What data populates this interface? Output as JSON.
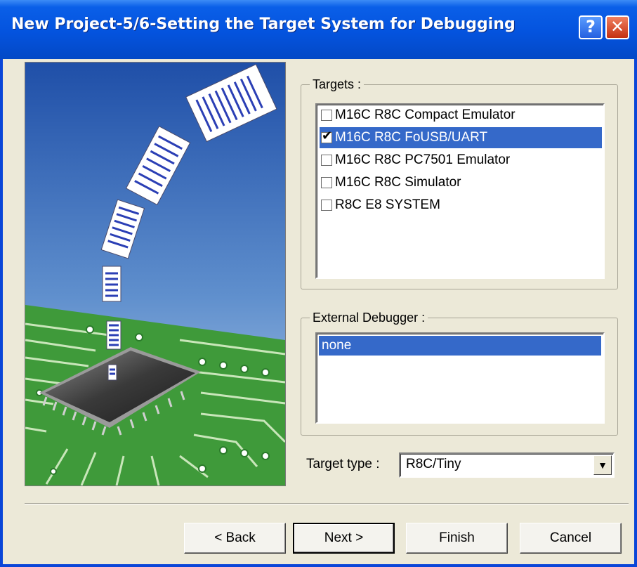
{
  "window": {
    "title": "New Project-5/6-Setting the Target System for Debugging"
  },
  "titlebar_buttons": {
    "help": "?",
    "close": "✕"
  },
  "targets": {
    "label": "Targets :",
    "items": [
      {
        "label": "M16C R8C Compact Emulator",
        "checked": false,
        "selected": false
      },
      {
        "label": "M16C R8C FoUSB/UART",
        "checked": true,
        "selected": true
      },
      {
        "label": "M16C R8C PC7501 Emulator",
        "checked": false,
        "selected": false
      },
      {
        "label": "M16C R8C Simulator",
        "checked": false,
        "selected": false
      },
      {
        "label": "R8C E8 SYSTEM",
        "checked": false,
        "selected": false
      }
    ]
  },
  "external_debugger": {
    "label": "External Debugger :",
    "items": [
      "none"
    ]
  },
  "target_type": {
    "label": "Target type :",
    "value": "R8C/Tiny"
  },
  "buttons": {
    "back": "< Back",
    "next": "Next >",
    "finish": "Finish",
    "cancel": "Cancel"
  },
  "colors": {
    "titlebar": "#0453de",
    "selection": "#3569c9",
    "dialog_bg": "#ece9d8"
  }
}
